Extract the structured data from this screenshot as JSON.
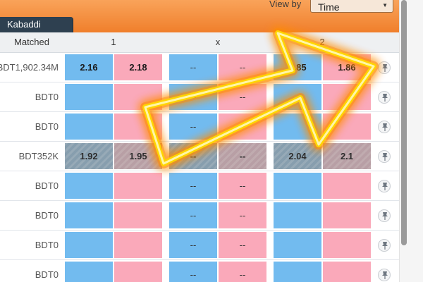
{
  "header": {
    "tab_label": "Kabaddi",
    "view_by_label": "View by",
    "view_by_value": "Time"
  },
  "columns": {
    "matched": "Matched",
    "col1": "1",
    "colx": "x",
    "col2": "2"
  },
  "rows": [
    {
      "matched": "BDT1,902.34M",
      "c1_back": "2.16",
      "c1_lay": "2.18",
      "x_back": "--",
      "x_lay": "--",
      "c2_back": "1.85",
      "c2_lay": "1.86",
      "suspended": false
    },
    {
      "matched": "BDT0",
      "c1_back": "",
      "c1_lay": "",
      "x_back": "--",
      "x_lay": "--",
      "c2_back": "",
      "c2_lay": "",
      "suspended": false
    },
    {
      "matched": "BDT0",
      "c1_back": "",
      "c1_lay": "",
      "x_back": "--",
      "x_lay": "--",
      "c2_back": "",
      "c2_lay": "",
      "suspended": false
    },
    {
      "matched": "BDT352K",
      "c1_back": "1.92",
      "c1_lay": "1.95",
      "x_back": "--",
      "x_lay": "--",
      "c2_back": "2.04",
      "c2_lay": "2.1",
      "suspended": true
    },
    {
      "matched": "BDT0",
      "c1_back": "",
      "c1_lay": "",
      "x_back": "--",
      "x_lay": "--",
      "c2_back": "",
      "c2_lay": "",
      "suspended": false
    },
    {
      "matched": "BDT0",
      "c1_back": "",
      "c1_lay": "",
      "x_back": "--",
      "x_lay": "--",
      "c2_back": "",
      "c2_lay": "",
      "suspended": false
    },
    {
      "matched": "BDT0",
      "c1_back": "",
      "c1_lay": "",
      "x_back": "--",
      "x_lay": "--",
      "c2_back": "",
      "c2_lay": "",
      "suspended": false
    },
    {
      "matched": "BDT0",
      "c1_back": "",
      "c1_lay": "",
      "x_back": "--",
      "x_lay": "--",
      "c2_back": "",
      "c2_lay": "",
      "suspended": false
    }
  ],
  "icons": {
    "pin": "pin-icon",
    "caret": "chevron-down-icon",
    "overlay_arrow": "glowing-arrow-icon"
  },
  "colors": {
    "topbar": "#f07f2c",
    "back": "#72bbef",
    "lay": "#faa9ba",
    "arrow_glow": "#ffd400",
    "arrow_edge": "#ff8c00"
  }
}
